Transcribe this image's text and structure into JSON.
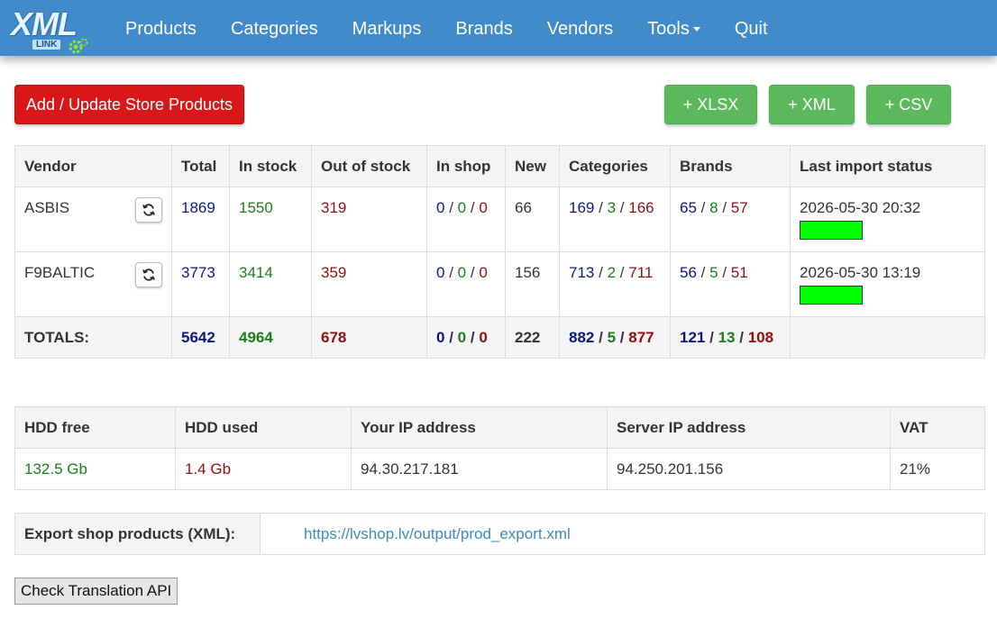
{
  "logo": {
    "text": "XML",
    "sub": "LINK"
  },
  "nav": {
    "items": [
      "Products",
      "Categories",
      "Markups",
      "Brands",
      "Vendors",
      "Tools",
      "Quit"
    ]
  },
  "buttons": {
    "add_update": "Add / Update Store Products",
    "xlsx": "+ XLSX",
    "xml": "+ XML",
    "csv": "+ CSV"
  },
  "vendors_table": {
    "headers": [
      "Vendor",
      "Total",
      "In stock",
      "Out of stock",
      "In shop",
      "New",
      "Categories",
      "Brands",
      "Last import status"
    ],
    "rows": [
      {
        "vendor": "ASBIS",
        "total": "1869",
        "in_stock": "1550",
        "out_of_stock": "319",
        "in_shop": [
          "0",
          "0",
          "0"
        ],
        "new": "66",
        "categories": [
          "169",
          "3",
          "166"
        ],
        "brands": [
          "65",
          "8",
          "57"
        ],
        "last_import": "2026-05-30 20:32",
        "status_color": "#00ff00"
      },
      {
        "vendor": "F9BALTIC",
        "total": "3773",
        "in_stock": "3414",
        "out_of_stock": "359",
        "in_shop": [
          "0",
          "0",
          "0"
        ],
        "new": "156",
        "categories": [
          "713",
          "2",
          "711"
        ],
        "brands": [
          "56",
          "5",
          "51"
        ],
        "last_import": "2026-05-30 13:19",
        "status_color": "#00ff00"
      }
    ],
    "totals": {
      "label": "TOTALS:",
      "total": "5642",
      "in_stock": "4964",
      "out_of_stock": "678",
      "in_shop": [
        "0",
        "0",
        "0"
      ],
      "new": "222",
      "categories": [
        "882",
        "5",
        "877"
      ],
      "brands": [
        "121",
        "13",
        "108"
      ]
    },
    "separator": "/"
  },
  "system_table": {
    "headers": [
      "HDD free",
      "HDD used",
      "Your IP address",
      "Server IP address",
      "VAT"
    ],
    "values": [
      "132.5 Gb",
      "1.4 Gb",
      "94.30.217.181",
      "94.250.201.156",
      "21%"
    ]
  },
  "export": {
    "label": "Export shop products (XML):",
    "url": "https://lvshop.lv/output/prod_export.xml"
  },
  "check_translation": "Check Translation API",
  "colors": {
    "navbar": "#428bca",
    "primary_blue": "#0b1a7a",
    "green": "#1e7b1e",
    "red": "#8b1111",
    "status_ok": "#00ff00",
    "danger_button": "#d9171a",
    "success_button": "#5cb85c"
  },
  "icons": {
    "refresh": "refresh-icon",
    "gear": "gear-icon",
    "caret": "caret-down-icon"
  }
}
